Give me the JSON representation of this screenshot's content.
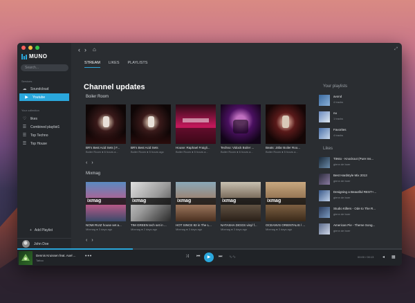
{
  "app": {
    "name": "MUNO"
  },
  "colors": {
    "accent": "#2aa7dc",
    "window": "#2a2d31",
    "sidebar": "#24272b"
  },
  "sidebar": {
    "search_placeholder": "Search...",
    "services_heading": "Services",
    "services": [
      {
        "label": "Soundcloud",
        "icon": "cloud-icon"
      },
      {
        "label": "Youtube",
        "icon": "play-icon",
        "active": true
      }
    ],
    "collection_heading": "Your collection",
    "collection": [
      {
        "label": "likes",
        "icon": "heart-icon"
      },
      {
        "label": "Combined playlist1",
        "icon": "playlist-icon"
      },
      {
        "label": "Top Techno",
        "icon": "playlist-icon"
      },
      {
        "label": "Top House",
        "icon": "playlist-icon"
      }
    ],
    "add_playlist": "Add Playlist",
    "user_name": "John Doe"
  },
  "tabs": [
    {
      "label": "STREAM",
      "active": true
    },
    {
      "label": "LIKES"
    },
    {
      "label": "PLAYLISTS"
    }
  ],
  "main": {
    "title": "Channel updates",
    "groups": [
      {
        "name": "Boiler Room",
        "cards": [
          {
            "title": "BR's Best Acid Sets | F...",
            "sub": "Boiler Room",
            "age": "6 hours a..."
          },
          {
            "title": "BR's Best Acid Sets",
            "sub": "Boiler Room",
            "age": "5 hours ago"
          },
          {
            "title": "House: Raphael Fraigli...",
            "sub": "Boiler Room",
            "age": "5 hours a..."
          },
          {
            "title": "Techno: Vidock Boiler ...",
            "sub": "Boiler Room",
            "age": "6 hours a..."
          },
          {
            "title": "Beats: Jäfar Boiler Roo...",
            "sub": "Boiler Room",
            "age": "5 hours a..."
          }
        ]
      },
      {
        "name": "Mixmag",
        "cards": [
          {
            "title": "NOMI RUIZ house set a...",
            "sub": "Mixmag",
            "age": "3 days ago",
            "logo": "ixmag"
          },
          {
            "title": "TIM GREEN tech set in ...",
            "sub": "Mixmag",
            "age": "2 days ago",
            "logo": "ixmag"
          },
          {
            "title": "HOT SINCE 82 in The L...",
            "sub": "Mixmag",
            "age": "3 days ago",
            "logo": "ixmag"
          },
          {
            "title": "NATASHA DIGGS vinyl f...",
            "sub": "Mixmag",
            "age": "3 days ago",
            "logo": "ixmag"
          },
          {
            "title": "OCEANVS ORIENTALIS / ...",
            "sub": "Mixmag",
            "age": "3 days ago",
            "logo": "ixmag"
          }
        ]
      }
    ]
  },
  "right": {
    "playlists_heading": "Your playlists",
    "playlists": [
      {
        "title": "avond",
        "sub": "4 tracks"
      },
      {
        "title": "nu",
        "sub": "1 tracks"
      },
      {
        "title": "Favorites",
        "sub": "4 tracks"
      }
    ],
    "likes_heading": "Likes",
    "likes": [
      {
        "title": "Tiësto - Knockout (Pure Ins...",
        "sub": "glenn de boer"
      },
      {
        "title": "Best Hardstyle Mix 2013",
        "sub": "glenn de boer"
      },
      {
        "title": "Designing a Beautiful REST+...",
        "sub": "glenn de boer"
      },
      {
        "title": "Studio Killers - Ode to The R...",
        "sub": "glenn de boer"
      },
      {
        "title": "American Pie - Theme Song...",
        "sub": "glenn de boer"
      }
    ]
  },
  "player": {
    "title": "Dennis Kruissen feat. Axel ...",
    "artist": "Tattoo",
    "time": "00:00 / 00:13",
    "progress": 0.3
  }
}
